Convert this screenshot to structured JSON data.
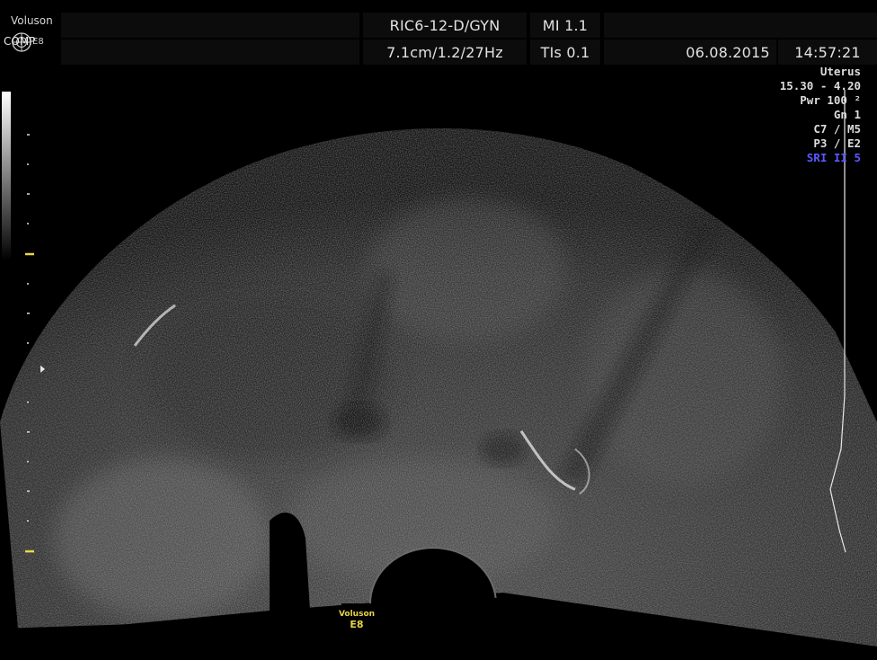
{
  "header": {
    "brand": "Voluson",
    "comp_label": "COMP",
    "model": "E8",
    "probe": "RIC6-12-D/GYN",
    "mi": "MI  1.1",
    "depth_info": "7.1cm/1.2/27Hz",
    "tis": "TIs  0.1",
    "date": "06.08.2015",
    "time": "14:57:21"
  },
  "params": {
    "preset": "Uterus",
    "frequency": "15.30 - 4.20",
    "power": "Pwr 100 ²",
    "gain": "Gn  1",
    "c_m": "C7 / M5",
    "p_e": "P3 / E2",
    "sri": "SRI II 5"
  },
  "footer": {
    "brand": "Voluson",
    "model": "E8"
  },
  "colors": {
    "highlight": "#5a5aff",
    "logo_yellow": "#e6d34a",
    "background": "#000000",
    "header_bar": "#0c0c0c"
  },
  "icons": {
    "comp": "comp-logo-icon",
    "focus": "focus-marker-icon"
  }
}
